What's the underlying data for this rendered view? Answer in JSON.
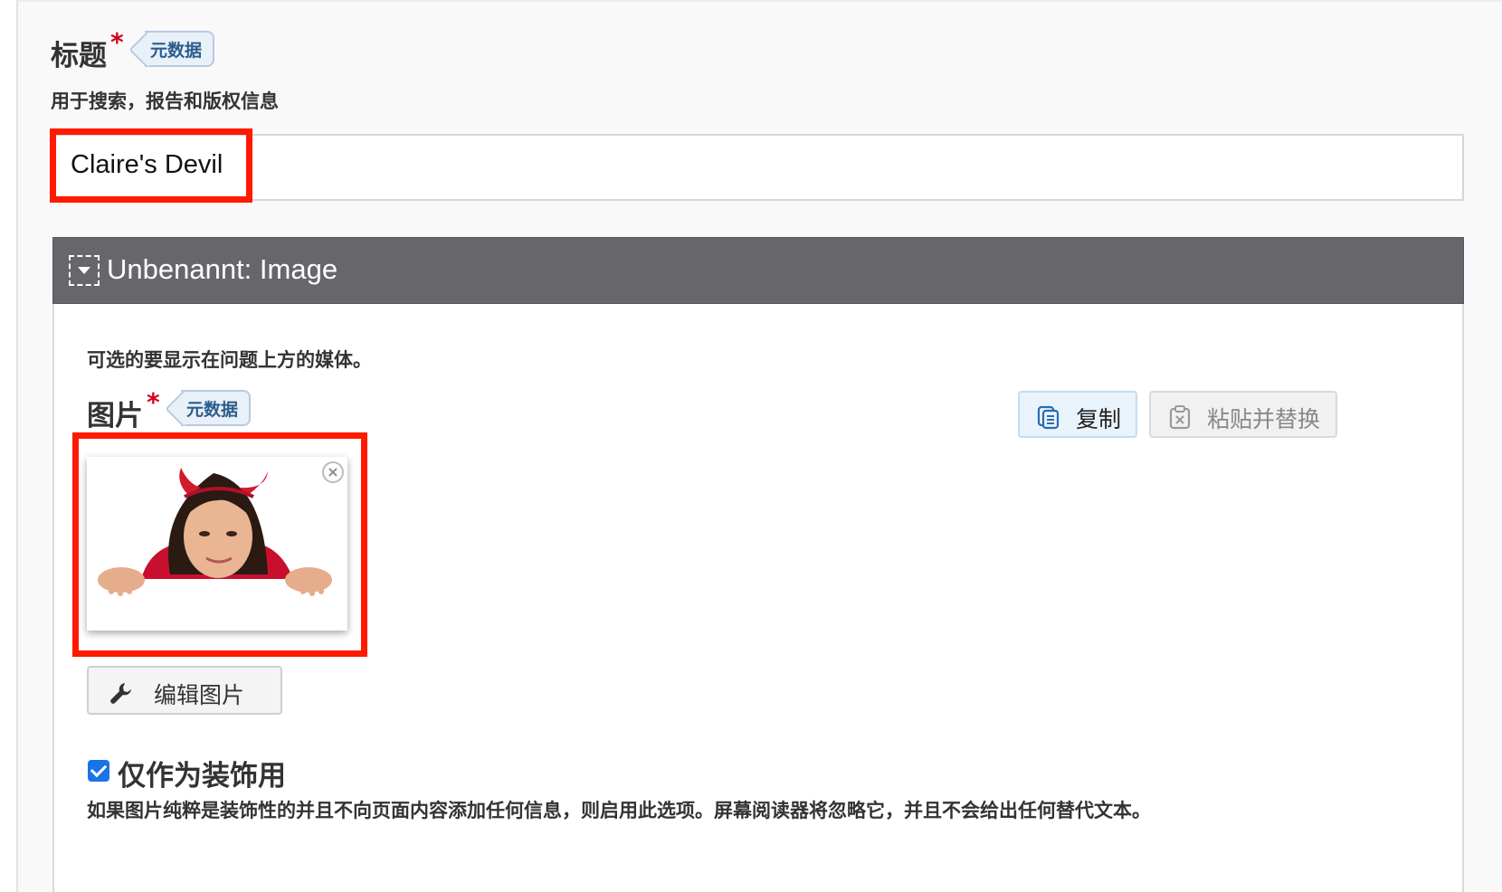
{
  "title_field": {
    "label": "标题",
    "required_mark": "*",
    "metadata_tag": "元数据",
    "description": "用于搜索，报告和版权信息",
    "value": "Claire's Devil"
  },
  "group": {
    "title": "Unbenannt: Image",
    "description": "可选的要显示在问题上方的媒体。"
  },
  "image_field": {
    "label": "图片",
    "required_mark": "*",
    "metadata_tag": "元数据",
    "copy_label": "复制",
    "paste_replace_label": "粘贴并替换",
    "remove_symbol": "×",
    "edit_label": "编辑图片"
  },
  "decorative": {
    "checked": true,
    "label": "仅作为装饰用",
    "description": "如果图片纯粹是装饰性的并且不向页面内容添加任何信息，则启用此选项。屏幕阅读器将忽略它，并且不会给出任何替代文本。"
  },
  "colors": {
    "highlight": "#ff1a00",
    "required": "#d0021b",
    "group_header": "#67666a",
    "checkbox": "#1a73e8"
  }
}
